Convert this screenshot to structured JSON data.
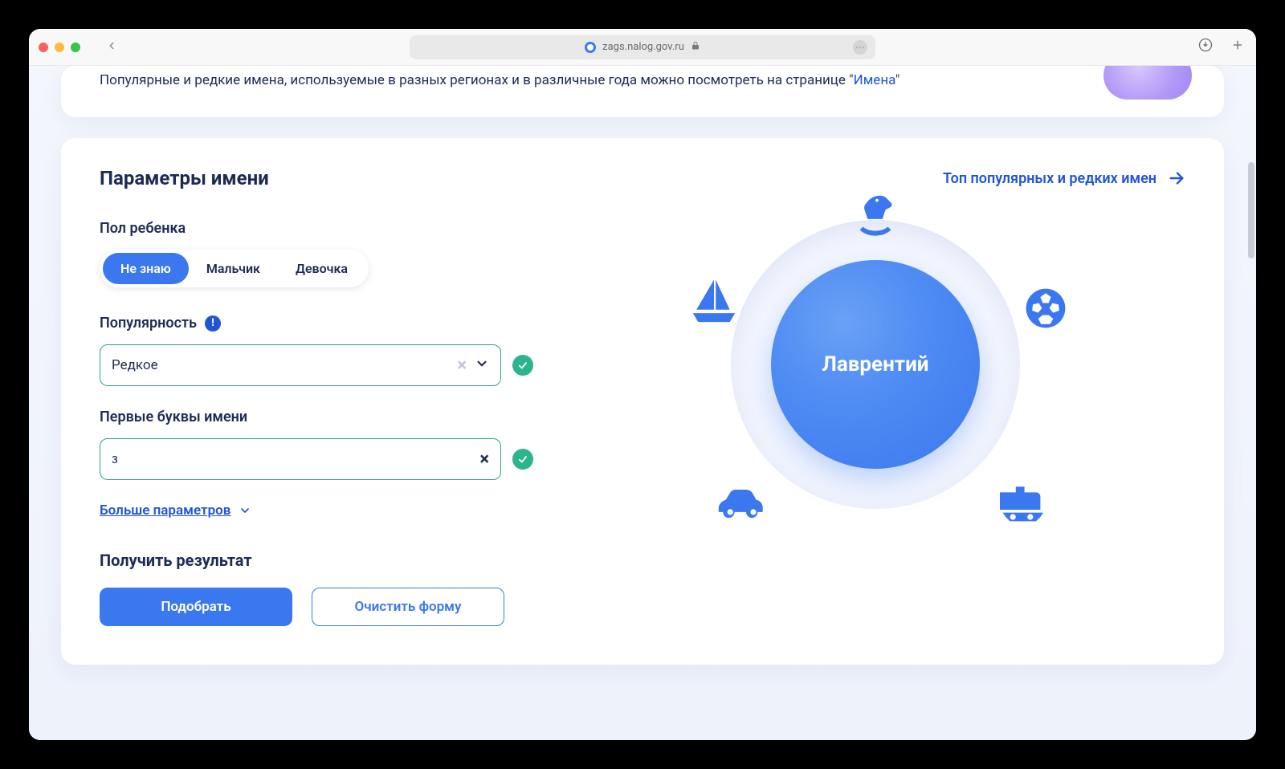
{
  "browser": {
    "url": "zags.nalog.gov.ru"
  },
  "banner": {
    "text_prefix": "Популярные и редкие имена, используемые в разных регионах и в различные года можно посмотреть на странице \"",
    "link_text": "Имена",
    "text_suffix": "\""
  },
  "form": {
    "title": "Параметры имени",
    "top_link": "Топ популярных и редких имен",
    "gender": {
      "label": "Пол ребенка",
      "options": [
        "Не знаю",
        "Мальчик",
        "Девочка"
      ],
      "selected_index": 0
    },
    "popularity": {
      "label": "Популярность",
      "value": "Редкое"
    },
    "first_letters": {
      "label": "Первые буквы имени",
      "value": "з"
    },
    "more_params": "Больше параметров",
    "result_title": "Получить результат",
    "submit": "Подобрать",
    "clear": "Очистить форму"
  },
  "wheel": {
    "name": "Лаврентий"
  }
}
